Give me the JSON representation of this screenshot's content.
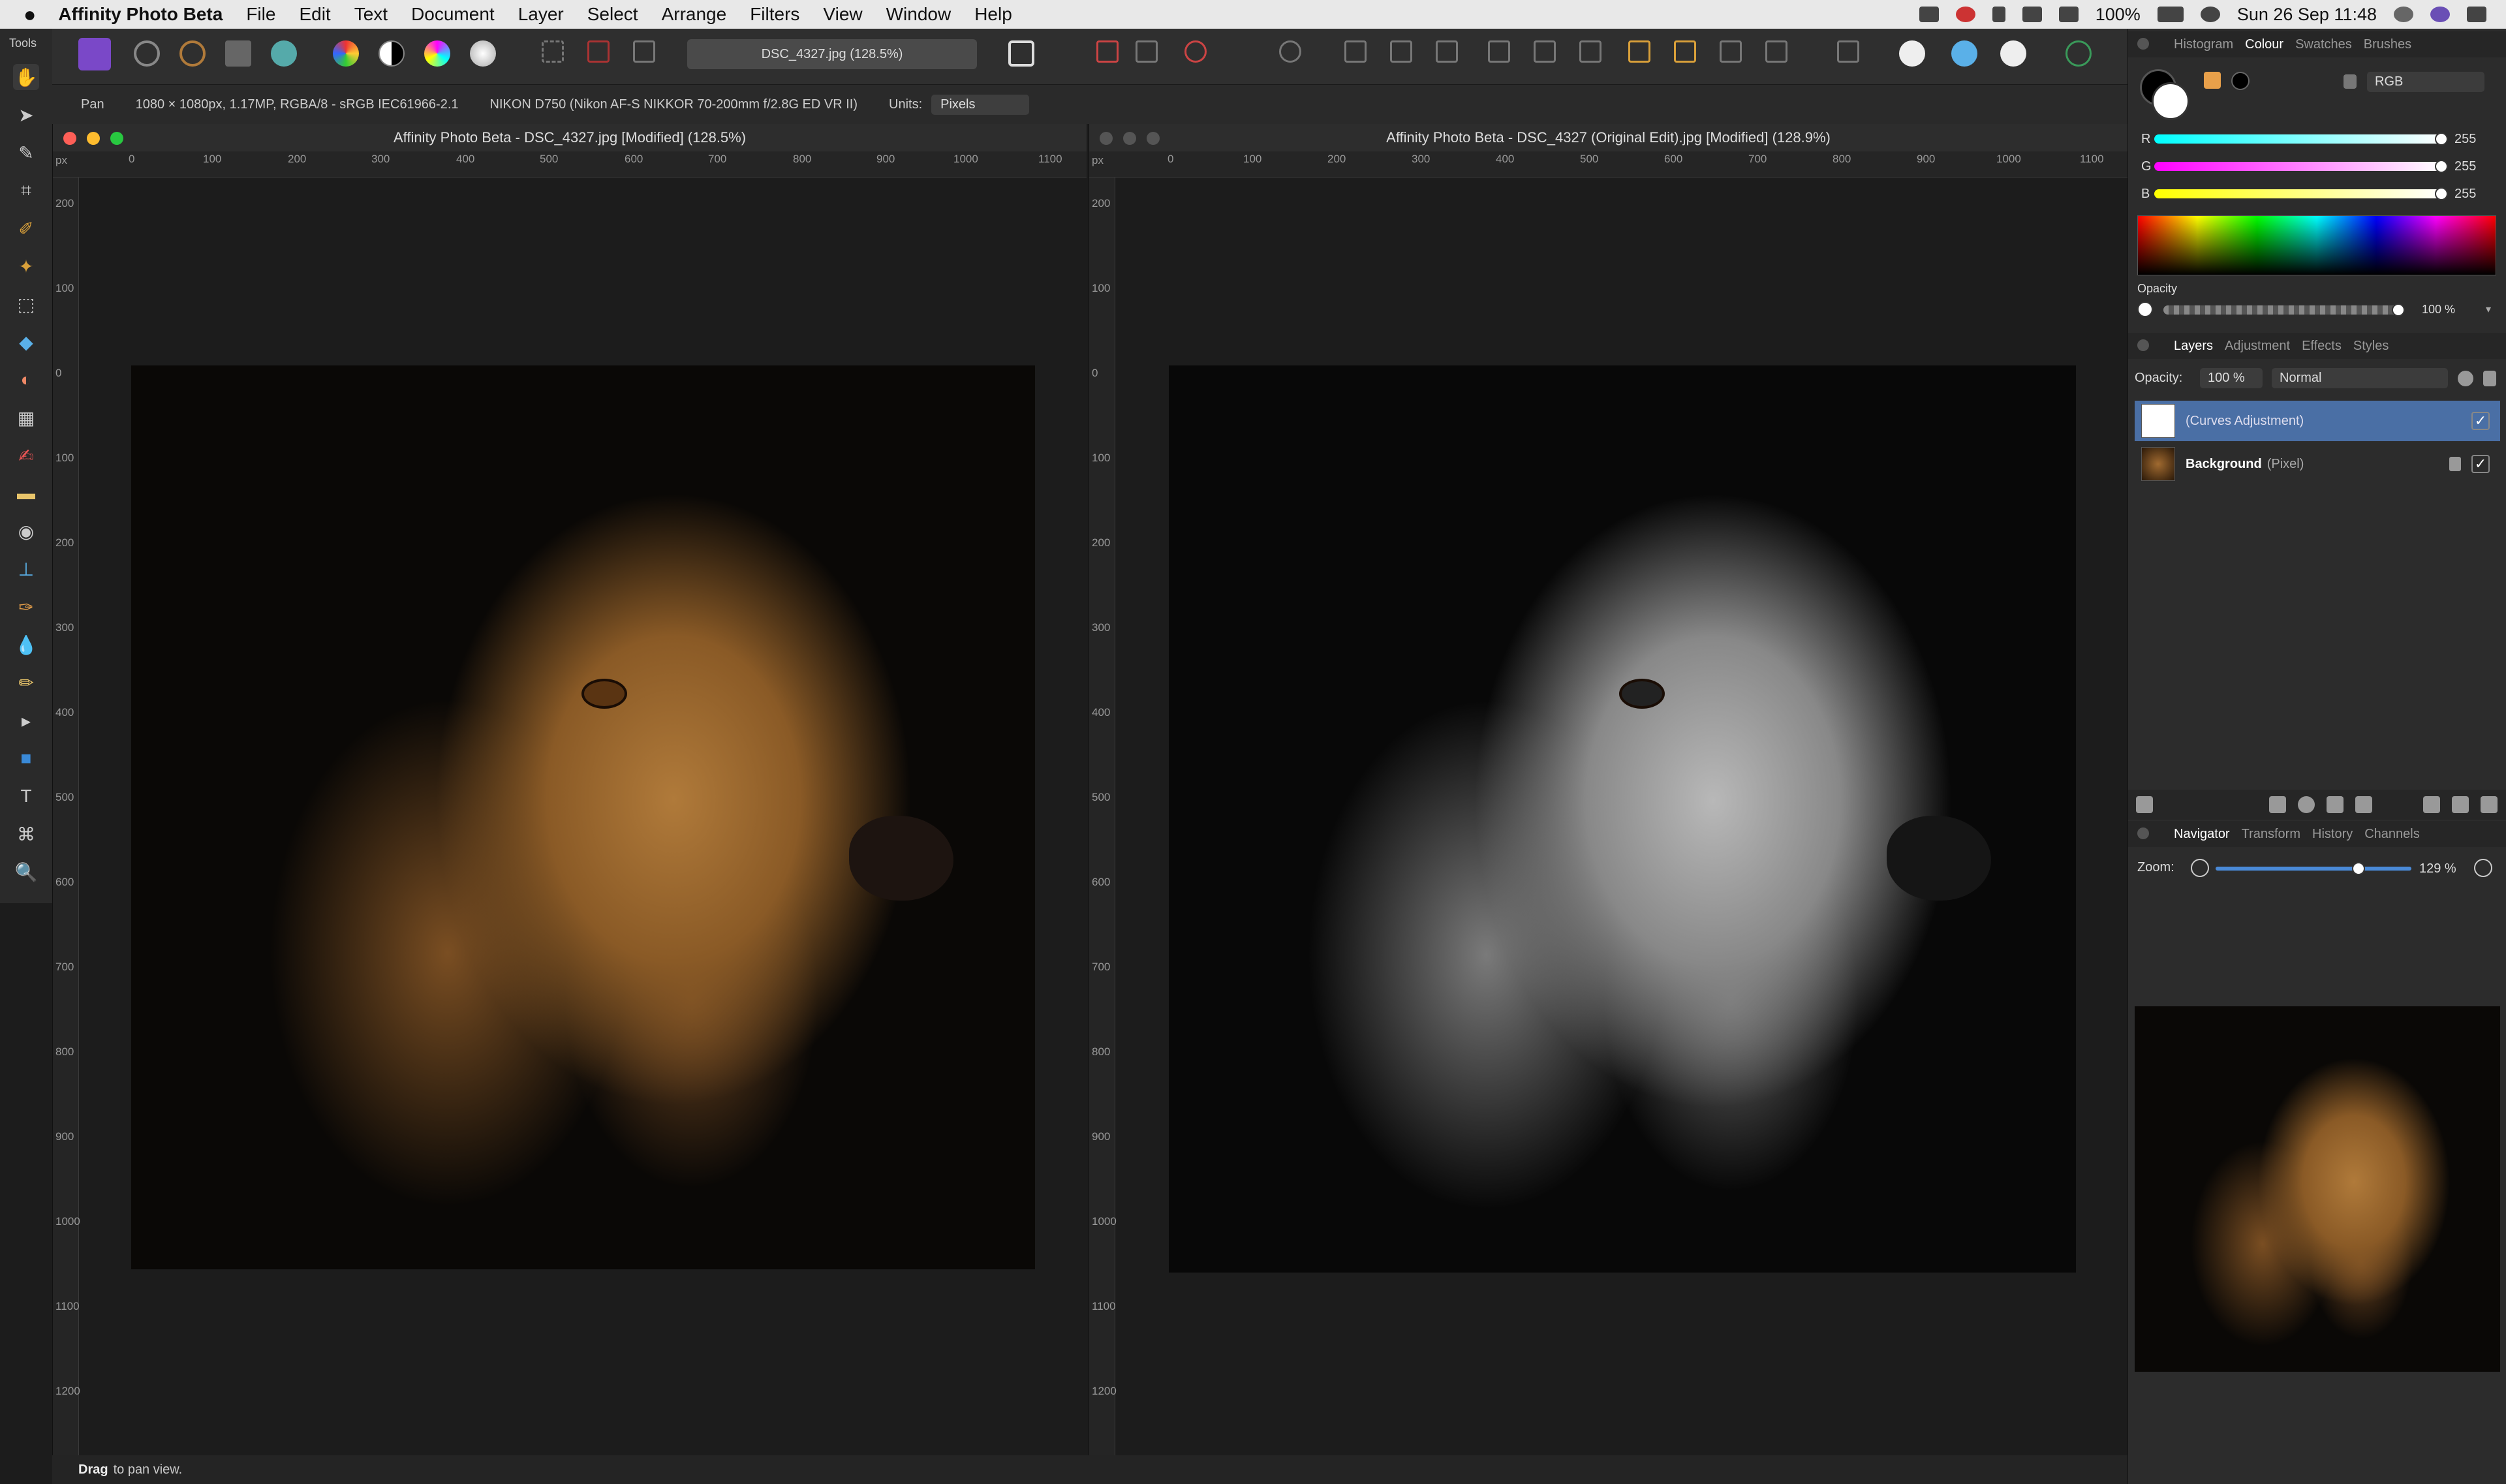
{
  "menubar": {
    "app_name": "Affinity Photo Beta",
    "items": [
      "File",
      "Edit",
      "Text",
      "Document",
      "Layer",
      "Select",
      "Arrange",
      "Filters",
      "View",
      "Window",
      "Help"
    ],
    "battery": "100%",
    "clock": "Sun 26 Sep  11:48"
  },
  "toolbar": {
    "document_select": "DSC_4327.jpg (128.5%)"
  },
  "context_toolbar": {
    "tool": "Pan",
    "doc_info": "1080 × 1080px, 1.17MP, RGBA/8 - sRGB IEC61966-2.1",
    "camera_info": "NIKON D750 (Nikon AF-S NIKKOR 70-200mm f/2.8G ED VR II)",
    "units_label": "Units:",
    "units_value": "Pixels"
  },
  "tools_panel": {
    "label": "Tools"
  },
  "document_left": {
    "title": "Affinity Photo Beta - DSC_4327.jpg [Modified] (128.5%)",
    "ruler_unit": "px",
    "h_ticks": [
      "0",
      "100",
      "200",
      "300",
      "400",
      "500",
      "600",
      "700",
      "800",
      "900",
      "1000",
      "1100"
    ],
    "v_ticks": [
      "200",
      "100",
      "0",
      "100",
      "200",
      "300",
      "400",
      "500",
      "600",
      "700",
      "800",
      "900",
      "1000",
      "1100",
      "1200"
    ]
  },
  "document_right": {
    "title": "Affinity Photo Beta - DSC_4327 (Original Edit).jpg [Modified] (128.9%)",
    "ruler_unit": "px",
    "h_ticks": [
      "0",
      "100",
      "200",
      "300",
      "400",
      "500",
      "600",
      "700",
      "800",
      "900",
      "1000",
      "1100"
    ],
    "v_ticks": [
      "200",
      "100",
      "0",
      "100",
      "200",
      "300",
      "400",
      "500",
      "600",
      "700",
      "800",
      "900",
      "1000",
      "1100",
      "1200"
    ]
  },
  "status_bar": {
    "bold": "Drag",
    "text": "to pan view."
  },
  "colour_panel": {
    "tabs": [
      "Histogram",
      "Colour",
      "Swatches",
      "Brushes"
    ],
    "active_tab": "Colour",
    "mode": "RGB",
    "r_label": "R",
    "r_value": "255",
    "g_label": "G",
    "g_value": "255",
    "b_label": "B",
    "b_value": "255",
    "opacity_label": "Opacity",
    "opacity_value": "100 %",
    "opacity_fraction": 1.0
  },
  "layers_panel": {
    "tabs": [
      "Layers",
      "Adjustment",
      "Effects",
      "Styles"
    ],
    "active_tab": "Layers",
    "opacity_label": "Opacity:",
    "opacity_value": "100 %",
    "blend_mode": "Normal",
    "layers": [
      {
        "name": "",
        "type": "(Curves Adjustment)",
        "selected": true,
        "visible": true
      },
      {
        "name": "Background",
        "type": "(Pixel)",
        "selected": false,
        "visible": true,
        "locked": true
      }
    ]
  },
  "navigator_panel": {
    "tabs": [
      "Navigator",
      "Transform",
      "History",
      "Channels"
    ],
    "active_tab": "Navigator",
    "zoom_label": "Zoom:",
    "zoom_value": "129 %",
    "zoom_fraction": 0.73
  },
  "colors": {
    "accent": "#4a6fa5",
    "close_red": "#fe5f57",
    "min_yellow": "#febc2e",
    "max_green": "#28c840"
  }
}
